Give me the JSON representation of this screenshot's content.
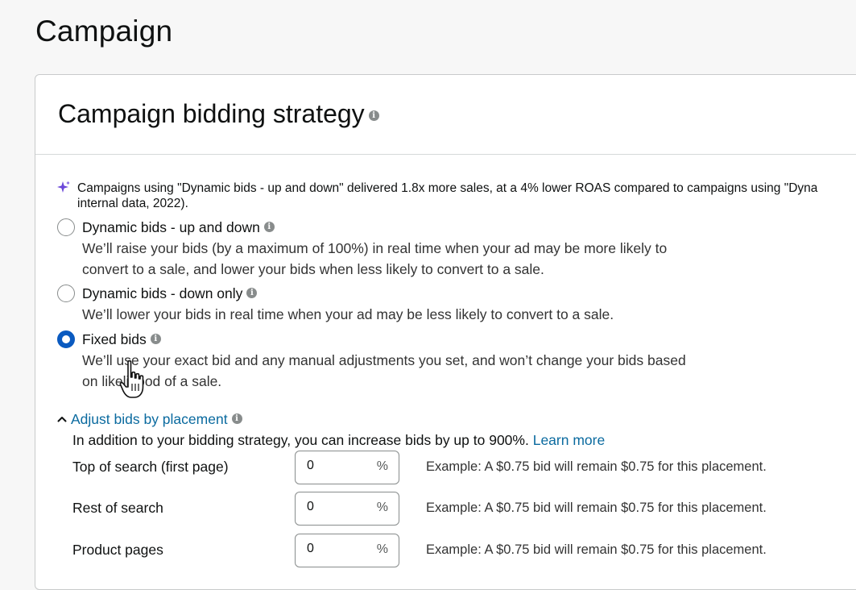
{
  "page": {
    "title": "Campaign"
  },
  "card": {
    "title": "Campaign bidding strategy",
    "ai_note_line1": "Campaigns using \"Dynamic bids - up and down\" delivered 1.8x more sales, at a 4% lower ROAS compared to campaigns using \"Dyna",
    "ai_note_line2": "internal data, 2022).",
    "options": [
      {
        "label": "Dynamic bids - up and down",
        "desc_line1": "We’ll raise your bids (by a maximum of 100%) in real time when your ad may be more likely to",
        "desc_line2": "convert to a sale, and lower your bids when less likely to convert to a sale.",
        "checked": false
      },
      {
        "label": "Dynamic bids - down only",
        "desc_line1": "We’ll lower your bids in real time when your ad may be less likely to convert to a sale.",
        "checked": false
      },
      {
        "label": "Fixed bids",
        "desc_line1": "We’ll use your exact bid and any manual adjustments you set, and won’t change your bids based",
        "desc_line2": "on likelihood of a sale.",
        "checked": true
      }
    ],
    "placement": {
      "toggle_label": "Adjust bids by placement",
      "intro": "In addition to your bidding strategy, you can increase bids by up to 900%.",
      "learn_more": "Learn more",
      "percent_symbol": "%",
      "rows": [
        {
          "label": "Top of search (first page)",
          "value": "0",
          "example": "Example: A $0.75 bid will remain $0.75 for this placement."
        },
        {
          "label": "Rest of search",
          "value": "0",
          "example": "Example: A $0.75 bid will remain $0.75 for this placement."
        },
        {
          "label": "Product pages",
          "value": "0",
          "example": "Example: A $0.75 bid will remain $0.75 for this placement."
        }
      ]
    }
  },
  "icons": {
    "info": "info-icon",
    "sparkle": "sparkle-icon",
    "chevron": "chevron-up-icon",
    "cursor": "hand-pointer-cursor"
  },
  "colors": {
    "link": "#0a6a9f",
    "radio_checked": "#0a5ac0",
    "sparkle": "#6b47d9",
    "info_icon": "#888c8c"
  }
}
